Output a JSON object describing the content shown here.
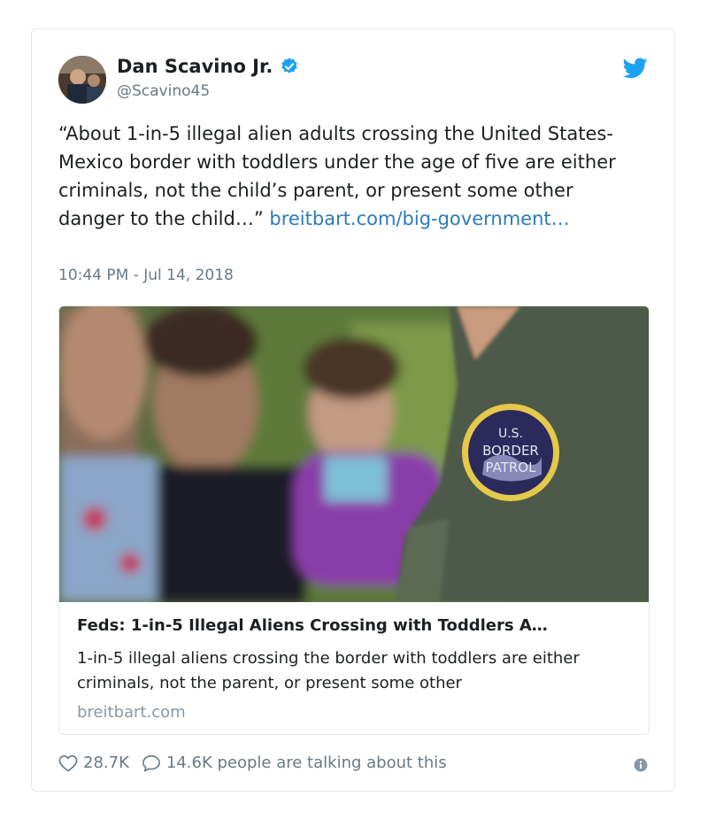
{
  "tweet": {
    "author_name": "Dan Scavino Jr.",
    "handle": "@Scavino45",
    "body": "“About 1-in-5 illegal alien adults crossing the United States-Mexico border with toddlers under the age of five are either criminals, not the child’s parent, or present some other danger to the child…” ",
    "link_text": "breitbart.com/big-government…",
    "timestamp": "10:44 PM - Jul 14, 2018"
  },
  "embed": {
    "title": "Feds: 1-in-5 Illegal Aliens Crossing with Toddlers A…",
    "description": "1-in-5 illegal aliens crossing the border with toddlers are either criminals, not the parent, or present some other",
    "domain": "breitbart.com",
    "patch_text_top": "U.S.",
    "patch_text_mid": "BORDER",
    "patch_text_bot": "PATROL"
  },
  "actions": {
    "likes": "28.7K",
    "talking": "14.6K people are talking about this"
  },
  "colors": {
    "link": "#2b7bb9",
    "twitter_blue": "#1da1f2",
    "muted": "#697882"
  },
  "icons": [
    "verified-icon",
    "twitter-bird-icon",
    "heart-icon",
    "comment-icon",
    "info-icon"
  ]
}
